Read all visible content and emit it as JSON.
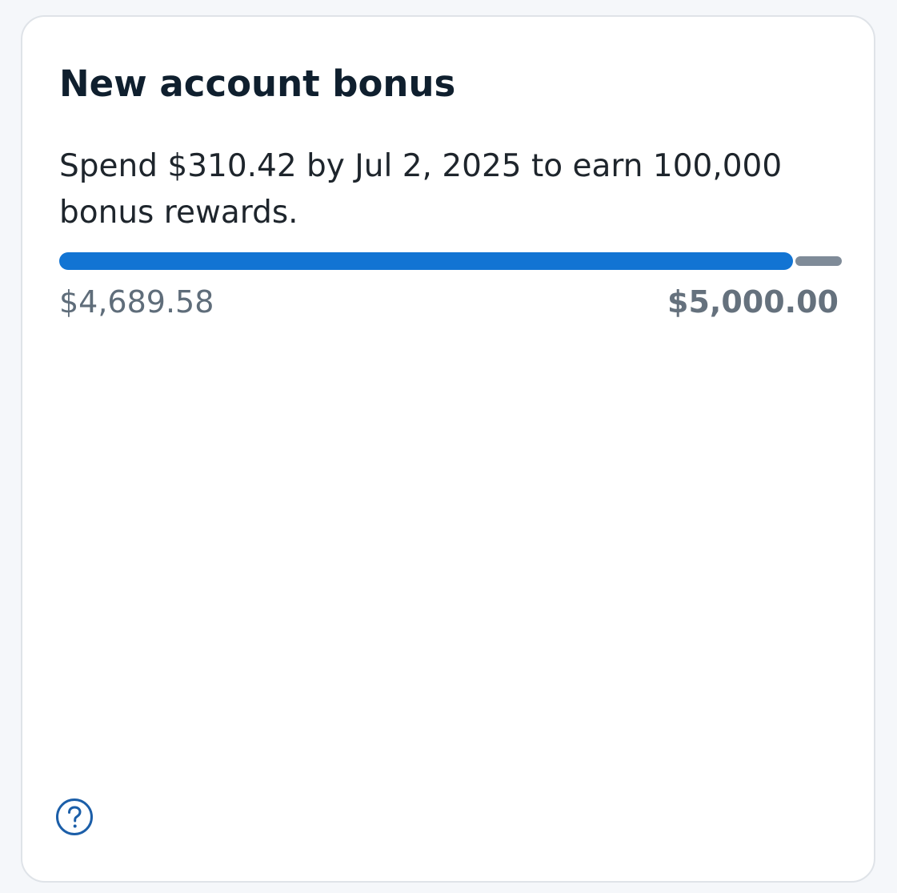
{
  "card": {
    "title": "New account bonus",
    "description": "Spend $310.42 by Jul 2, 2025 to earn 100,000 bonus rewards.",
    "progress": {
      "current_label": "$4,689.58",
      "goal_label": "$5,000.00",
      "current_value": 4689.58,
      "goal_value": 5000.0,
      "fill_color": "#1274d3",
      "track_color": "#7f8b98"
    },
    "help": {
      "icon": "question-circle-icon",
      "color": "#1b5ea8"
    }
  }
}
